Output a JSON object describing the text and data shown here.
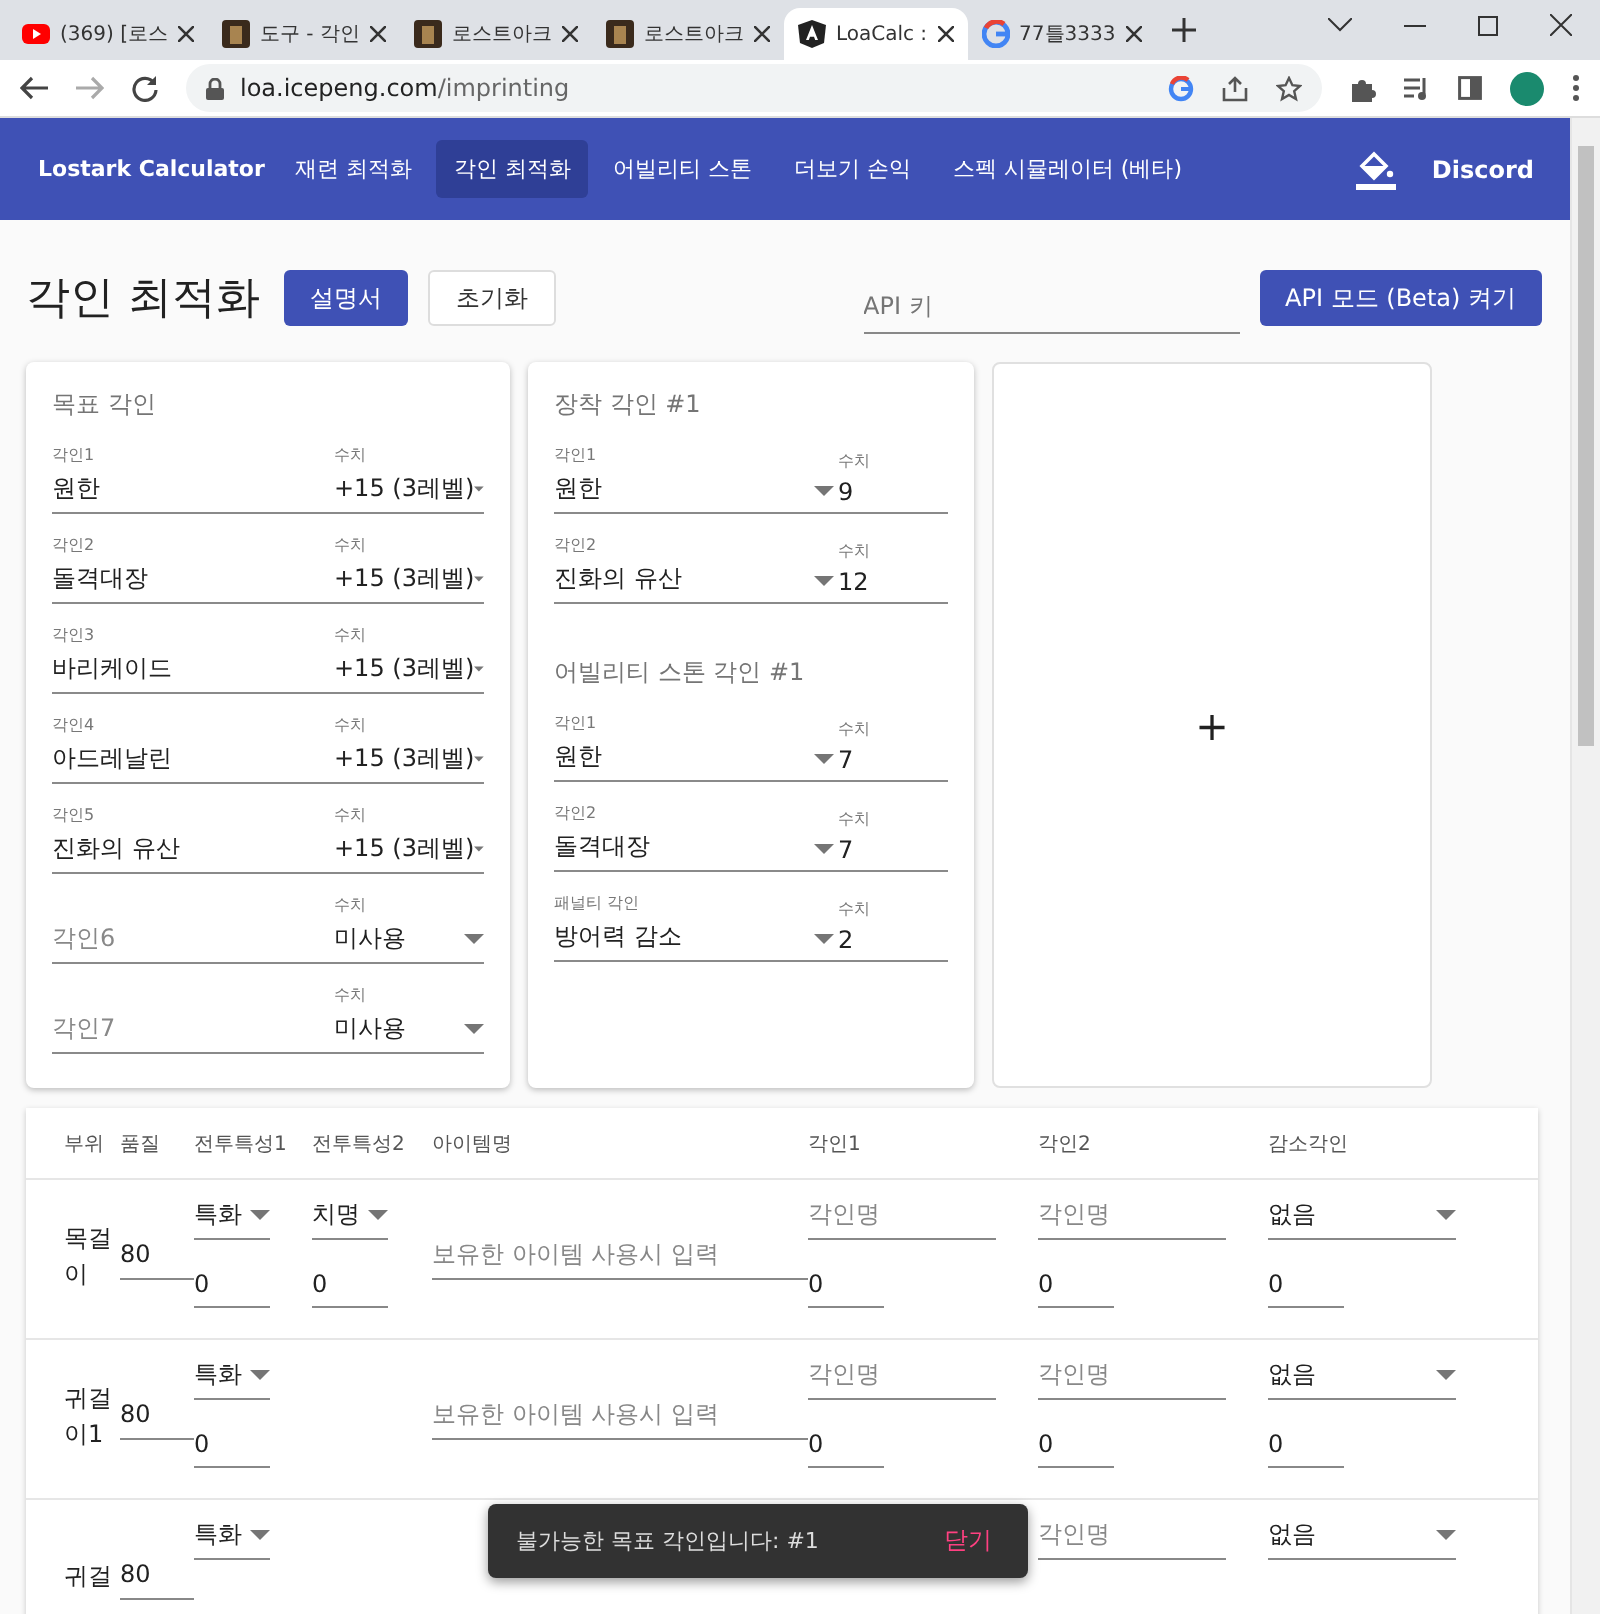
{
  "browser": {
    "tabs": [
      {
        "title": "(369) [로스",
        "selected": false
      },
      {
        "title": "도구 - 각인",
        "selected": false
      },
      {
        "title": "로스트아크",
        "selected": false
      },
      {
        "title": "로스트아크",
        "selected": false
      },
      {
        "title": "LoaCalc :",
        "selected": true
      },
      {
        "title": "77틀3333",
        "selected": false
      }
    ],
    "url_host": "loa.icepeng.com",
    "url_path": "/imprinting"
  },
  "nav": {
    "brand": "Lostark Calculator",
    "items": [
      {
        "label": "재련 최적화",
        "selected": false
      },
      {
        "label": "각인 최적화",
        "selected": true
      },
      {
        "label": "어빌리티 스톤",
        "selected": false
      },
      {
        "label": "더보기 손익",
        "selected": false
      },
      {
        "label": "스펙 시뮬레이터 (베타)",
        "selected": false
      }
    ],
    "discord": "Discord"
  },
  "page": {
    "title": "각인 최적화",
    "buttons": [
      {
        "label": "설명서",
        "kind": "primary"
      },
      {
        "label": "초기화",
        "kind": "outline"
      }
    ],
    "api_key_placeholder": "API 키",
    "api_button": "API 모드 (Beta) 켜기"
  },
  "target": {
    "title": "목표 각인",
    "rows": [
      {
        "label": "각인1",
        "value": "원한",
        "level_label": "수치",
        "level_value": "+15 (3레벨)"
      },
      {
        "label": "각인2",
        "value": "돌격대장",
        "level_label": "수치",
        "level_value": "+15 (3레벨)"
      },
      {
        "label": "각인3",
        "value": "바리케이드",
        "level_label": "수치",
        "level_value": "+15 (3레벨)"
      },
      {
        "label": "각인4",
        "value": "아드레날린",
        "level_label": "수치",
        "level_value": "+15 (3레벨)"
      },
      {
        "label": "각인5",
        "value": "진화의 유산",
        "level_label": "수치",
        "level_value": "+15 (3레벨)"
      },
      {
        "placeholder": "각인6",
        "level_label": "수치",
        "level_value": "미사용"
      },
      {
        "placeholder": "각인7",
        "level_label": "수치",
        "level_value": "미사용"
      }
    ]
  },
  "equipped": {
    "title": "장착 각인 #1",
    "rows": [
      {
        "label": "각인1",
        "value": "원한",
        "level_label": "수치",
        "level_value": "9"
      },
      {
        "label": "각인2",
        "value": "진화의 유산",
        "level_label": "수치",
        "level_value": "12"
      }
    ]
  },
  "stone": {
    "title": "어빌리티 스톤 각인 #1",
    "rows": [
      {
        "label": "각인1",
        "value": "원한",
        "level_label": "수치",
        "level_value": "7"
      },
      {
        "label": "각인2",
        "value": "돌격대장",
        "level_label": "수치",
        "level_value": "7"
      },
      {
        "label": "패널티 각인",
        "value": "방어력 감소",
        "level_label": "수치",
        "level_value": "2"
      }
    ]
  },
  "add_card": {
    "symbol": "+"
  },
  "table": {
    "columns": [
      "부위",
      "품질",
      "전투특성1",
      "전투특성2",
      "아이템명",
      "각인1",
      "각인2",
      "감소각인"
    ],
    "rows": [
      {
        "part": "목걸이",
        "quality": "80",
        "trait1": "특화",
        "trait1_value": "0",
        "trait2": "치명",
        "trait2_value": "0",
        "item_placeholder": "보유한 아이템 사용시 입력",
        "engr1_placeholder": "각인명",
        "engr1_value": "0",
        "engr2_placeholder": "각인명",
        "engr2_value": "0",
        "reduce": "없음",
        "reduce_value": "0"
      },
      {
        "part": "귀걸이1",
        "quality": "80",
        "trait1": "특화",
        "trait1_value": "0",
        "item_placeholder": "보유한 아이템 사용시 입력",
        "engr1_placeholder": "각인명",
        "engr1_value": "0",
        "engr2_placeholder": "각인명",
        "engr2_value": "0",
        "reduce": "없음",
        "reduce_value": "0"
      },
      {
        "part": "귀걸",
        "quality": "80",
        "trait1": "특화",
        "engr2_placeholder": "각인명",
        "reduce": "없음"
      }
    ]
  },
  "snackbar": {
    "message": "불가능한 목표 각인입니다: #1",
    "action": "닫기"
  }
}
